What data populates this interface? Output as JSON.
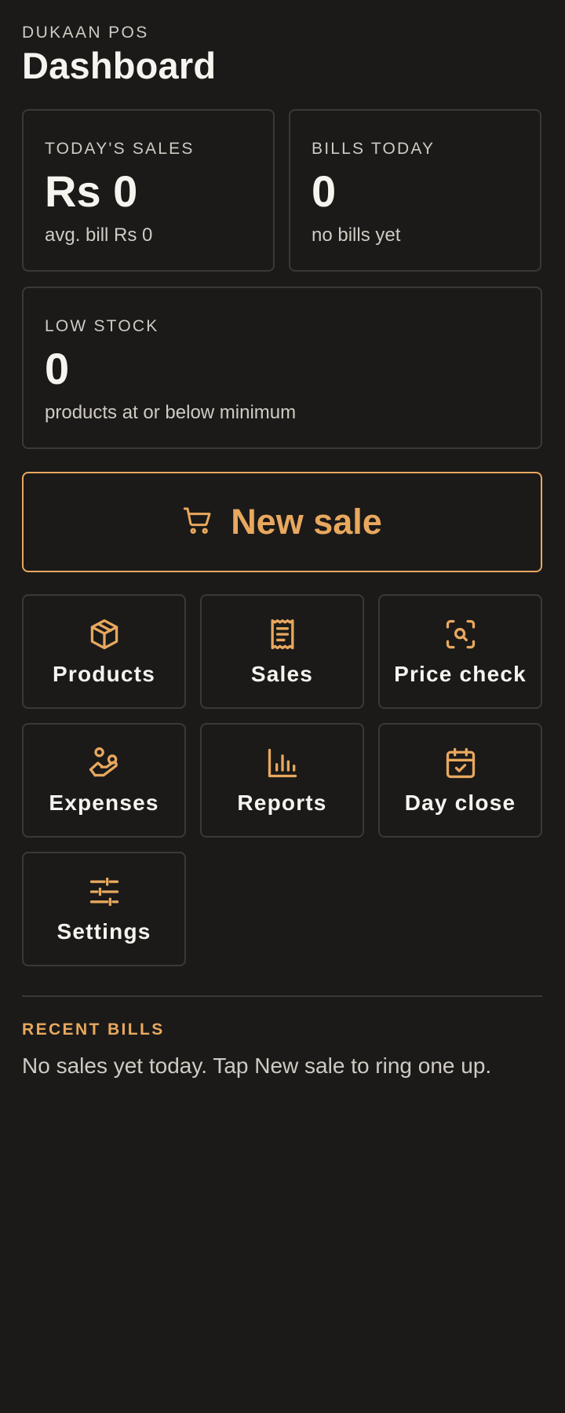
{
  "header": {
    "app_name": "DUKAAN POS",
    "title": "Dashboard"
  },
  "stats": {
    "sales": {
      "label": "TODAY'S SALES",
      "value": "Rs 0",
      "sub": "avg. bill Rs 0"
    },
    "bills": {
      "label": "BILLS TODAY",
      "value": "0",
      "sub": "no bills yet"
    },
    "low_stock": {
      "label": "LOW STOCK",
      "value": "0",
      "sub": "products at or below minimum"
    }
  },
  "new_sale": {
    "label": "New sale",
    "icon": "cart-icon"
  },
  "tiles": [
    {
      "label": "Products",
      "icon": "box-icon"
    },
    {
      "label": "Sales",
      "icon": "receipt-icon"
    },
    {
      "label": "Price check",
      "icon": "scan-search-icon"
    },
    {
      "label": "Expenses",
      "icon": "hand-coins-icon"
    },
    {
      "label": "Reports",
      "icon": "bar-chart-icon"
    },
    {
      "label": "Day close",
      "icon": "calendar-check-icon"
    },
    {
      "label": "Settings",
      "icon": "sliders-icon"
    }
  ],
  "recent": {
    "heading": "RECENT BILLS",
    "empty_text": "No sales yet today. Tap New sale to ring one up."
  },
  "colors": {
    "background": "#1b1a19",
    "accent": "#e8a85e",
    "border": "#3b3936",
    "text": "#f6f4ef",
    "muted": "#cfcbc3"
  }
}
